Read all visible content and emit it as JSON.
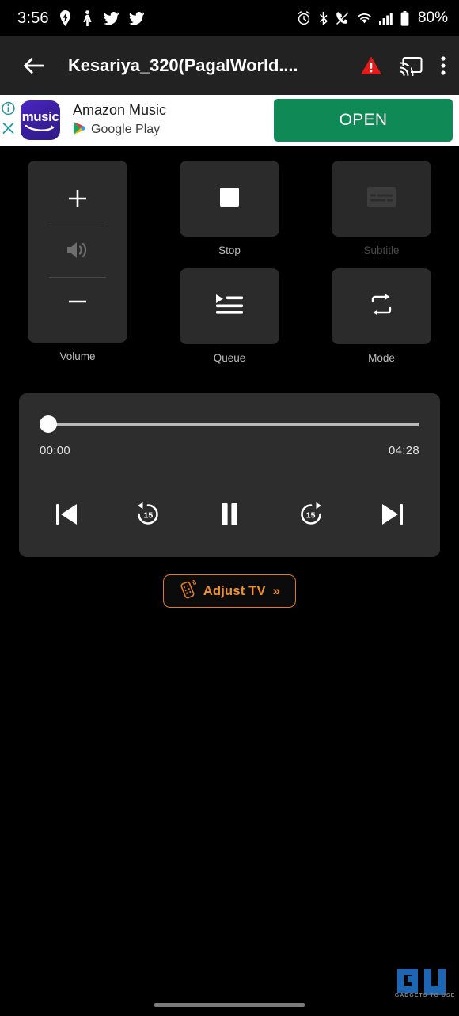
{
  "status_bar": {
    "time": "3:56",
    "battery_percent": "80%",
    "left_icons": [
      "location-icon",
      "person-walking-icon",
      "twitter-icon",
      "twitter-icon"
    ],
    "right_icons": [
      "alarm-icon",
      "bluetooth-icon",
      "call-mute-icon",
      "wifi-icon",
      "signal-bars-icon",
      "battery-icon"
    ]
  },
  "app_bar": {
    "title": "Kesariya_320(PagalWorld....",
    "back_icon": "arrow-left-icon",
    "warning_icon": "warning-triangle-icon",
    "cast_icon": "cast-icon",
    "overflow_icon": "more-vertical-icon"
  },
  "ad": {
    "app_icon_text": "music",
    "title": "Amazon Music",
    "source": "Google Play",
    "cta_label": "OPEN",
    "info_icon": "ad-info-icon",
    "close_icon": "ad-close-icon",
    "cta_color": "#0f8a56"
  },
  "controls": {
    "stop": {
      "label": "Stop",
      "icon": "stop-square-icon",
      "enabled": true
    },
    "subtitle": {
      "label": "Subtitle",
      "icon": "subtitle-icon",
      "enabled": false
    },
    "queue": {
      "label": "Queue",
      "icon": "playlist-queue-icon",
      "enabled": true
    },
    "mode": {
      "label": "Mode",
      "icon": "repeat-icon",
      "enabled": true
    },
    "volume": {
      "label": "Volume",
      "plus_icon": "plus-icon",
      "speaker_icon": "speaker-volume-icon",
      "minus_icon": "minus-icon"
    }
  },
  "player": {
    "current_time": "00:00",
    "total_time": "04:28",
    "progress_percent": 0,
    "transport": [
      {
        "name": "previous-track-button",
        "icon": "skip-previous-icon"
      },
      {
        "name": "rewind-15-button",
        "icon": "replay-15-icon",
        "seconds": "15"
      },
      {
        "name": "play-pause-button",
        "icon": "pause-icon"
      },
      {
        "name": "forward-15-button",
        "icon": "forward-15-icon",
        "seconds": "15"
      },
      {
        "name": "next-track-button",
        "icon": "skip-next-icon"
      }
    ]
  },
  "adjust_tv": {
    "label": "Adjust TV",
    "chevron": "»",
    "icon": "tv-remote-icon",
    "accent_color": "#f0912c"
  },
  "watermark": {
    "text": "GADGETS TO USE",
    "color": "#1f6fc4"
  }
}
